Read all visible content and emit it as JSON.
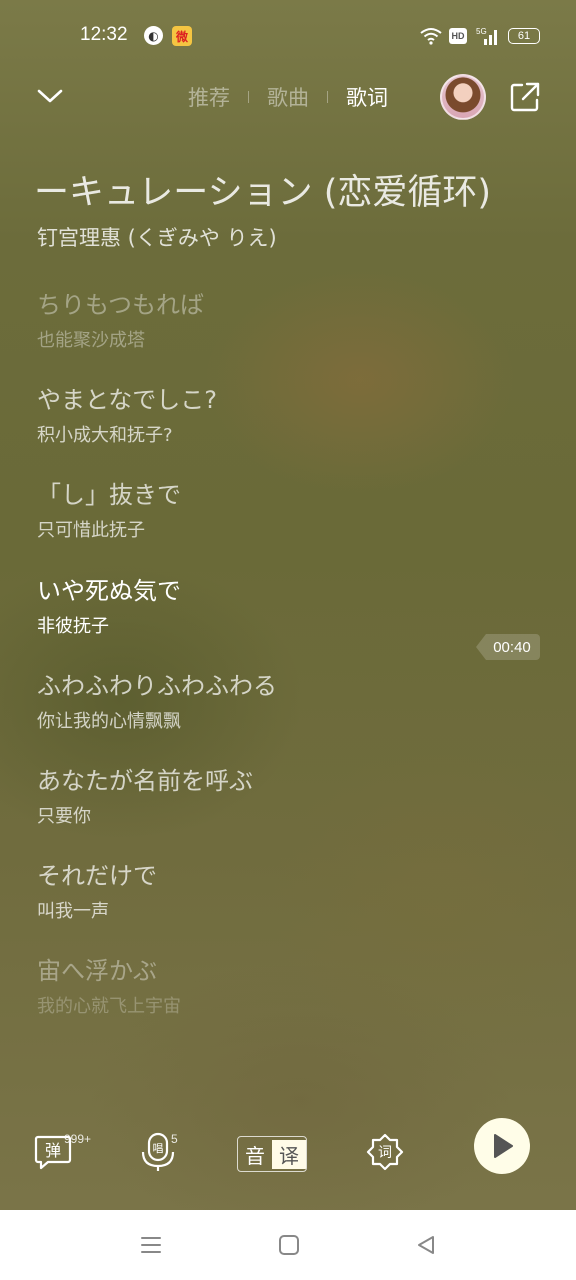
{
  "status_bar": {
    "time": "12:32",
    "battery": "61",
    "hd_label": "HD",
    "network_label": "5G"
  },
  "nav": {
    "tabs": [
      {
        "label": "推荐",
        "active": false
      },
      {
        "label": "歌曲",
        "active": false
      },
      {
        "label": "歌词",
        "active": true
      }
    ]
  },
  "song": {
    "title": "ーキュレーション (恋爱循环)",
    "artist": "钉宫理惠 (くぎみや りえ)"
  },
  "lyrics": [
    {
      "jp": "ちりもつもれば",
      "cn": "也能聚沙成塔",
      "state": "faded"
    },
    {
      "jp": "やまとなでしこ?",
      "cn": "积小成大和抚子?",
      "state": "normal"
    },
    {
      "jp": "「し」抜きで",
      "cn": "只可惜此抚子",
      "state": "normal"
    },
    {
      "jp": "いや死ぬ気で",
      "cn": "非彼抚子",
      "state": "current"
    },
    {
      "jp": "ふわふわりふわふわる",
      "cn": "你让我的心情飘飘",
      "state": "normal"
    },
    {
      "jp": "あなたが名前を呼ぶ",
      "cn": "只要你",
      "state": "normal"
    },
    {
      "jp": "それだけで",
      "cn": "叫我一声",
      "state": "normal"
    },
    {
      "jp": "宙へ浮かぶ",
      "cn": "我的心就飞上宇宙",
      "state": "last"
    }
  ],
  "timestamp": "00:40",
  "toolbar": {
    "danmu_label": "弹",
    "danmu_count": "999+",
    "sing_label": "唱",
    "sing_count": "5",
    "toggle_left": "音",
    "toggle_right": "译",
    "lyrics_label": "词"
  },
  "icons": {
    "collapse": "chevron-down-icon",
    "share": "share-icon",
    "play": "play-icon"
  },
  "colors": {
    "play_button_bg": "#fffde8",
    "toggle_active_bg": "#fffbe8"
  }
}
